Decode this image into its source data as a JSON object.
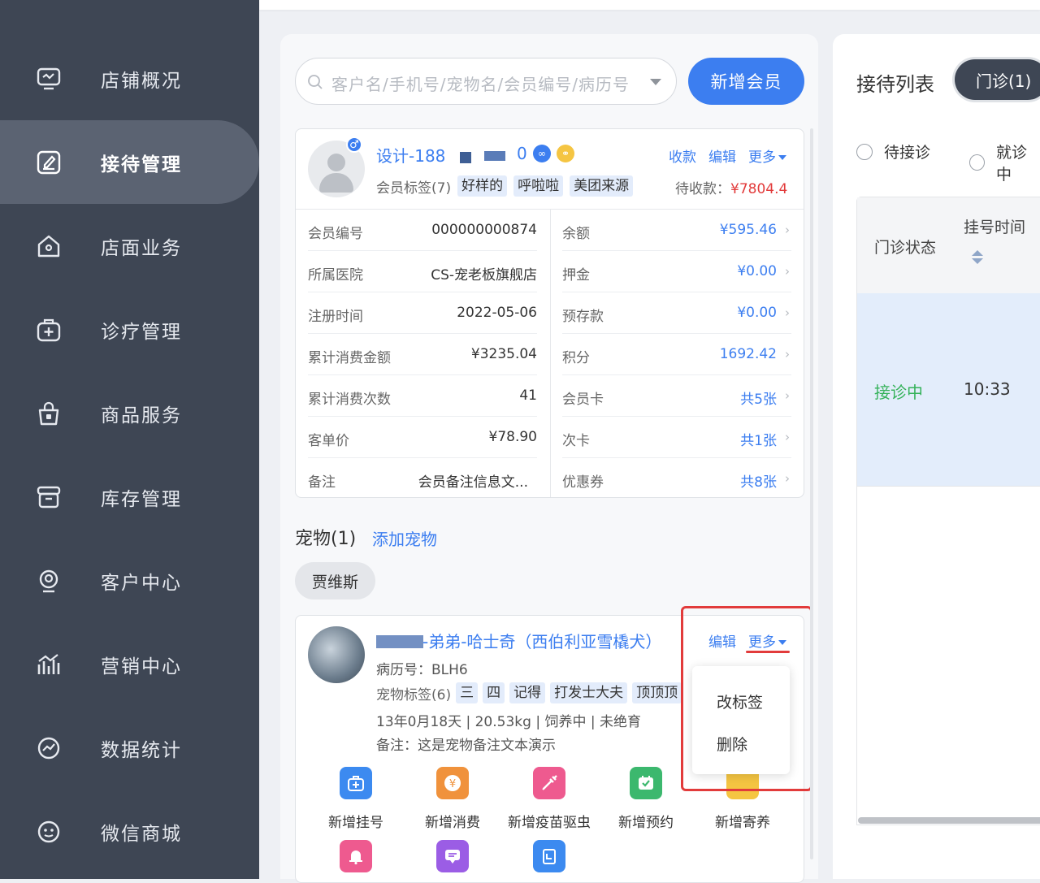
{
  "sidebar": {
    "items": [
      {
        "label": "店铺概况",
        "icon": "monitor-icon"
      },
      {
        "label": "接待管理",
        "icon": "clipboard-edit-icon",
        "active": true
      },
      {
        "label": "店面业务",
        "icon": "store-icon"
      },
      {
        "label": "诊疗管理",
        "icon": "medical-kit-icon"
      },
      {
        "label": "商品服务",
        "icon": "shopping-bag-icon"
      },
      {
        "label": "库存管理",
        "icon": "inventory-box-icon"
      },
      {
        "label": "客户中心",
        "icon": "customer-icon"
      },
      {
        "label": "营销中心",
        "icon": "chart-bar-icon"
      },
      {
        "label": "数据统计",
        "icon": "stats-icon"
      },
      {
        "label": "微信商城",
        "icon": "wechat-icon"
      }
    ]
  },
  "search": {
    "placeholder": "客户名/手机号/宠物名/会员编号/病历号"
  },
  "new_member_label": "新增会员",
  "member": {
    "name": "设计-188",
    "name_suffix": "0",
    "gender_symbol": "♂",
    "actions": {
      "collect": "收款",
      "edit": "编辑",
      "more": "更多"
    },
    "tags_label": "会员标签(7)",
    "tags": [
      "好样的",
      "呼啦啦",
      "美团来源"
    ],
    "due_label": "待收款：",
    "due_amount": "¥7804.4",
    "left_rows": [
      {
        "key": "会员编号",
        "value": "000000000874"
      },
      {
        "key": "所属医院",
        "value": "CS-宠老板旗舰店"
      },
      {
        "key": "注册时间",
        "value": "2022-05-06"
      },
      {
        "key": "累计消费金额",
        "value": "¥3235.04"
      },
      {
        "key": "累计消费次数",
        "value": "41"
      },
      {
        "key": "客单价",
        "value": "¥78.90"
      },
      {
        "key": "备注",
        "value": "会员备注信息文..."
      }
    ],
    "right_rows": [
      {
        "key": "余额",
        "value": "¥595.46"
      },
      {
        "key": "押金",
        "value": "¥0.00"
      },
      {
        "key": "预存款",
        "value": "¥0.00"
      },
      {
        "key": "积分",
        "value": "1692.42"
      },
      {
        "key": "会员卡",
        "value": "共5张"
      },
      {
        "key": "次卡",
        "value": "共1张"
      },
      {
        "key": "优惠券",
        "value": "共8张"
      }
    ]
  },
  "pets": {
    "title": "宠物(1)",
    "add_label": "添加宠物",
    "chip": "贾维斯",
    "card": {
      "name": "-弟弟-哈士奇（西伯利亚雪橇犬）",
      "record_no": "病历号：BLH6",
      "tags_label": "宠物标签(6)",
      "tags": [
        "三",
        "四",
        "记得",
        "打发士大夫",
        "顶顶顶"
      ],
      "info": "13年0月18天 | 20.53kg | 饲养中 |  未绝育",
      "note": "备注：这是宠物备注文本演示",
      "edit": "编辑",
      "more": "更多",
      "menu": [
        "改标签",
        "删除"
      ]
    },
    "quick_actions": [
      {
        "label": "新增挂号",
        "icon": "medical-kit-icon",
        "color": "#3c8af0"
      },
      {
        "label": "新增消费",
        "icon": "yuan-coin-icon",
        "color": "#f0923c"
      },
      {
        "label": "新增疫苗驱虫",
        "icon": "syringe-icon",
        "color": "#ee5a8f"
      },
      {
        "label": "新增预约",
        "icon": "calendar-check-icon",
        "color": "#3cb86e"
      },
      {
        "label": "新增寄养",
        "icon": "house-icon",
        "color": "#f5c542"
      },
      {
        "label": "",
        "icon": "bell-icon",
        "color": "#ee5a8f"
      },
      {
        "label": "",
        "icon": "chat-icon",
        "color": "#9b5de5"
      },
      {
        "label": "",
        "icon": "clipboard-icon",
        "color": "#3c8af0"
      }
    ]
  },
  "reception": {
    "title": "接待列表",
    "tab": "门诊(1)",
    "filters": [
      "待接诊",
      "就诊中"
    ],
    "columns": [
      "门诊状态",
      "挂号时间"
    ],
    "rows": [
      {
        "status": "接诊中",
        "time": "10:33"
      }
    ]
  }
}
